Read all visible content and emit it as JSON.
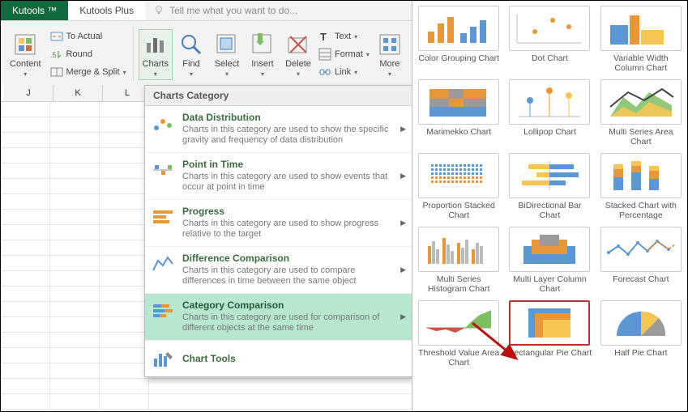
{
  "tabs": {
    "kutools": "Kutools ™",
    "plus": "Kutools Plus",
    "tell": "Tell me what you want to do..."
  },
  "ribbon": {
    "content": "Content",
    "actual": "To Actual",
    "round": "Round",
    "merge": "Merge & Split",
    "charts": "Charts",
    "find": "Find",
    "select": "Select",
    "insert": "Insert",
    "delete": "Delete",
    "text": "Text",
    "format": "Format",
    "link": "Link",
    "more": "More"
  },
  "dd": {
    "title": "Charts Category",
    "c1t": "Data Distribution",
    "c1d": "Charts in this category are used to show the specific gravity and frequency of data distribution",
    "c2t": "Point in Time",
    "c2d": "Charts in this category are used to show events that occur at point in time",
    "c3t": "Progress",
    "c3d": "Charts in this category are used to show progress relative to the target",
    "c4t": "Difference Comparison",
    "c4d": "Charts in this category are used to compare differences in time between the same object",
    "c5t": "Category Comparison",
    "c5d": "Charts in this category are used for comparison of different objects at the same time",
    "tools": "Chart Tools"
  },
  "cols": {
    "j": "J",
    "k": "K",
    "l": "L"
  },
  "gal": {
    "g1": "Color Grouping Chart",
    "g2": "Dot Chart",
    "g3": "Variable Width Column Chart",
    "g4": "Marimekko Chart",
    "g5": "Lollipop Chart",
    "g6": "Multi Series Area Chart",
    "g7": "Proportion Stacked Chart",
    "g8": "BiDirectional Bar Chart",
    "g9": "Stacked Chart with Percentage",
    "g10": "Multi Series Histogram Chart",
    "g11": "Multi Layer Column Chart",
    "g12": "Forecast Chart",
    "g13": "Threshold Value Area Chart",
    "g14": "Rectangular Pie Chart",
    "g15": "Half Pie Chart"
  }
}
